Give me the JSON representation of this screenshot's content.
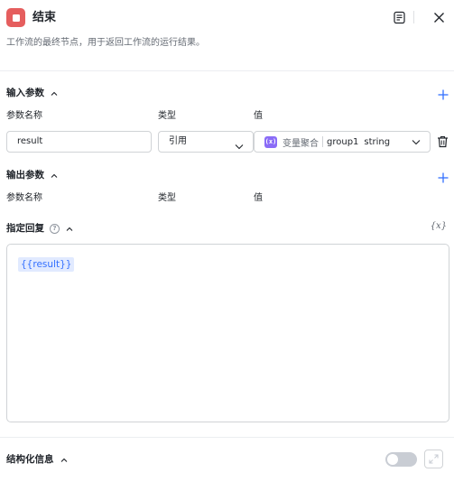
{
  "header": {
    "title": "结束",
    "description": "工作流的最终节点，用于返回工作流的运行结果。",
    "icon_color": "#e55e5e"
  },
  "input_params": {
    "title": "输入参数",
    "columns": [
      "参数名称",
      "类型",
      "值"
    ],
    "rows": [
      {
        "name": "result",
        "type": "引用",
        "ref_node": "变量聚合",
        "ref_variable": "group1",
        "ref_type": "string",
        "ref_badge": "(x)"
      }
    ]
  },
  "output_params": {
    "title": "输出参数",
    "columns": [
      "参数名称",
      "类型",
      "值"
    ]
  },
  "reply": {
    "title": "指定回复",
    "help_glyph": "?",
    "variable_button": "{x}",
    "content_token": "{{result}}"
  },
  "structured_info": {
    "title": "结构化信息",
    "enabled": false
  },
  "colors": {
    "accent": "#3370ff",
    "token_bg": "#e1eaff",
    "variable_badge": "#8a6cf7",
    "toggle_off": "#c9cdd4"
  }
}
